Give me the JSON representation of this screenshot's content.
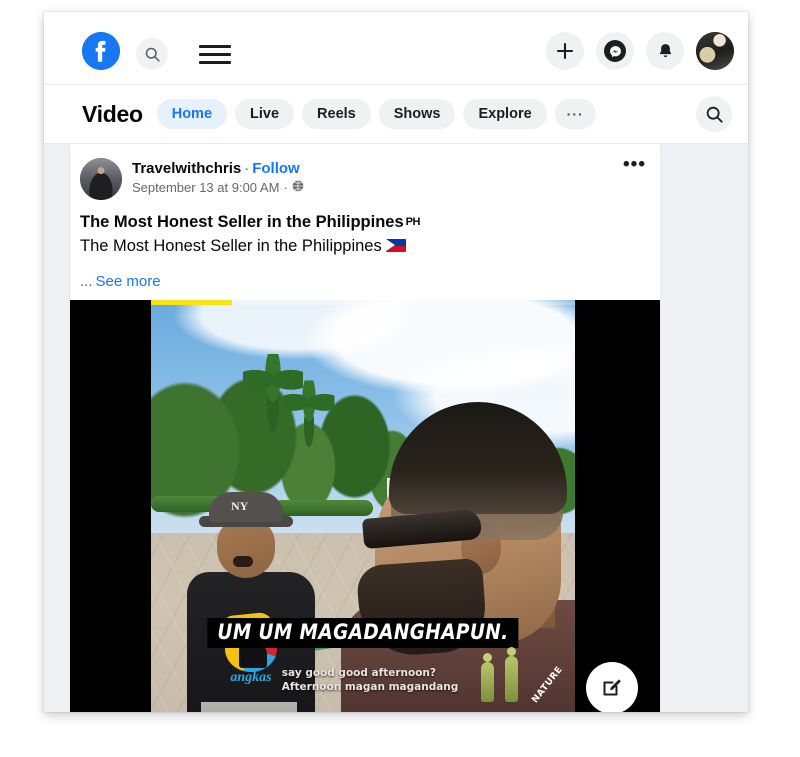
{
  "topbar": {
    "logo_name": "facebook-logo",
    "search_placeholder": "Search Facebook",
    "menu_label": "Menu",
    "plus_label": "+",
    "messenger_label": "Messenger",
    "notifications_label": "Notifications",
    "account_label": "Account"
  },
  "videonav": {
    "title": "Video",
    "tabs": [
      {
        "label": "Home",
        "active": true
      },
      {
        "label": "Live",
        "active": false
      },
      {
        "label": "Reels",
        "active": false
      },
      {
        "label": "Shows",
        "active": false
      },
      {
        "label": "Explore",
        "active": false
      }
    ],
    "more_label": "···",
    "search_label": "Search videos"
  },
  "post": {
    "author": "Travelwithchris",
    "separator": "·",
    "follow_label": "Follow",
    "timestamp": "September 13 at 9:00 AM",
    "audience": "Public",
    "menu_label": "•••",
    "text_line1": "The Most Honest Seller in the Philippines",
    "text_line1_flag": "PH",
    "text_line2": "The Most Honest Seller in the Philippines",
    "see_more_ellipsis": "...",
    "see_more_label": "See more"
  },
  "video": {
    "progress_percent": 19,
    "progress_color": "#f5e316",
    "caption_main": "UM UM MAGADANGHAPUN.",
    "caption_sub_line1": "say good good afternoon?",
    "caption_sub_line2": "Afternoon magan magandang",
    "sticker_text": "NATURE",
    "shirt_logo_text": "angkas",
    "cap_text": "NY"
  },
  "fab": {
    "label": "Create",
    "icon": "compose-icon"
  },
  "colors": {
    "brand": "#1877f2",
    "active_pill_bg": "#e7f0fd",
    "pill_bg": "#eff1f3",
    "page_bg": "#eef0f3",
    "text": "#080809",
    "muted": "#65676b"
  }
}
